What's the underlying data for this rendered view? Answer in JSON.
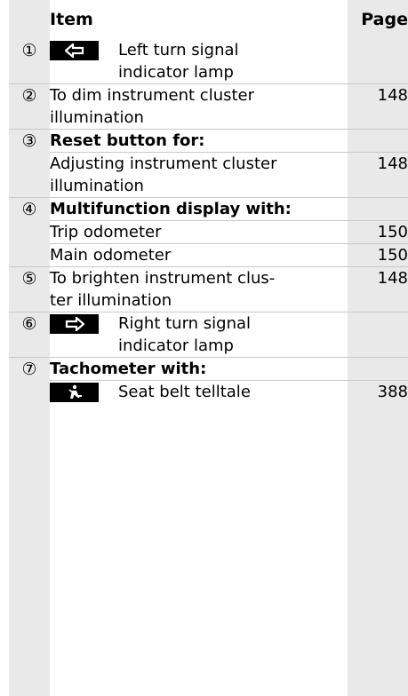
{
  "header": {
    "item": "Item",
    "page": "Page"
  },
  "rows": [
    {
      "num": "1",
      "icon": "left-arrow-icon",
      "text": "Left turn signal\nindicator lamp",
      "page": ""
    },
    {
      "num": "2",
      "text": "To dim instrument cluster\nillumination",
      "page": "148"
    },
    {
      "num": "3",
      "text": "Reset button for:",
      "bold": true,
      "page": ""
    },
    {
      "num": "",
      "text": "Adjusting instrument cluster\nillumination",
      "page": "148"
    },
    {
      "num": "4",
      "text": "Multifunction display with:",
      "bold": true,
      "page": ""
    },
    {
      "num": "",
      "text": "Trip odometer",
      "page": "150"
    },
    {
      "num": "",
      "text": "Main odometer",
      "page": "150"
    },
    {
      "num": "5",
      "text": "To brighten instrument clus-\nter illumination",
      "page": "148"
    },
    {
      "num": "6",
      "icon": "right-arrow-icon",
      "text": "Right turn signal\nindicator lamp",
      "page": ""
    },
    {
      "num": "7",
      "text": "Tachometer with:",
      "bold": true,
      "page": ""
    },
    {
      "num": "",
      "icon": "seat-belt-icon",
      "text": "Seat belt telltale",
      "page": "388"
    }
  ],
  "numerals": {
    "1": "①",
    "2": "②",
    "3": "③",
    "4": "④",
    "5": "⑤",
    "6": "⑥",
    "7": "⑦"
  }
}
